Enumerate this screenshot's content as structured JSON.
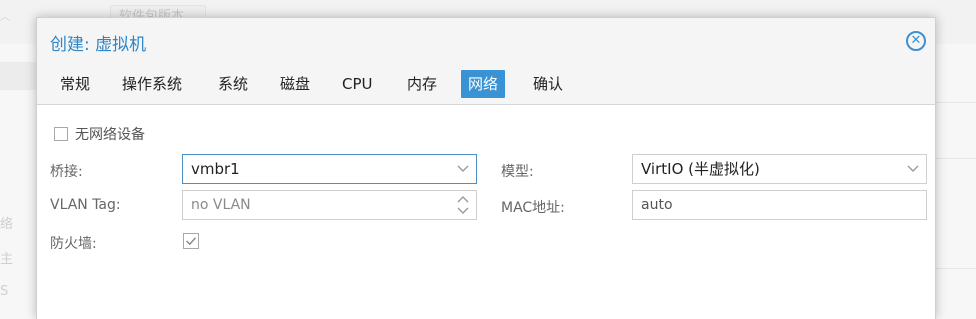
{
  "background": {
    "top_button_label": "软件包版本",
    "left_items": [
      "络",
      "主",
      "S"
    ]
  },
  "dialog": {
    "title": "创建: 虚拟机",
    "close_icon": "close-circle-icon",
    "tabs": [
      {
        "label": "常规",
        "active": false
      },
      {
        "label": "操作系统",
        "active": false
      },
      {
        "label": "系统",
        "active": false
      },
      {
        "label": "磁盘",
        "active": false
      },
      {
        "label": "CPU",
        "active": false
      },
      {
        "label": "内存",
        "active": false
      },
      {
        "label": "网络",
        "active": true
      },
      {
        "label": "确认",
        "active": false
      }
    ]
  },
  "form": {
    "no_network_label": "无网络设备",
    "no_network_checked": false,
    "bridge_label": "桥接:",
    "bridge_value": "vmbr1",
    "vlan_label": "VLAN Tag:",
    "vlan_value": "no VLAN",
    "firewall_label": "防火墙:",
    "firewall_checked": true,
    "model_label": "模型:",
    "model_value": "VirtIO (半虚拟化)",
    "mac_label": "MAC地址:",
    "mac_value": "auto"
  },
  "colors": {
    "accent": "#3892d4",
    "title": "#2e86c9",
    "focus_border": "#4a90c6"
  }
}
